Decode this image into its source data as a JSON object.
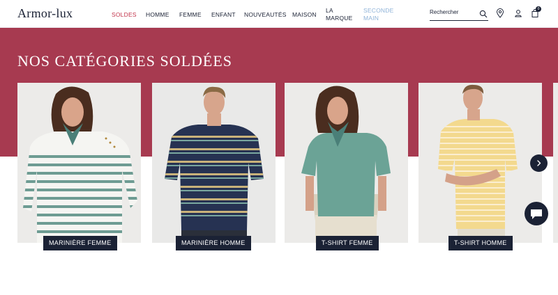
{
  "header": {
    "logo": "Armor-lux",
    "nav": [
      "SOLDES",
      "HOMME",
      "FEMME",
      "ENFANT",
      "NOUVEAUTÉS",
      "MAISON"
    ],
    "nav_la_marque": [
      "LA",
      "MARQUE"
    ],
    "nav_seconde_main": [
      "SECONDE",
      "MAIN"
    ],
    "search_placeholder": "Rechercher",
    "cart_count": "0",
    "icons": [
      "search-icon",
      "location-pin-icon",
      "account-icon",
      "cart-icon"
    ]
  },
  "hero": {
    "title": "NOS CATÉGORIES SOLDÉES",
    "band_color": "#a73a50"
  },
  "categories": [
    {
      "label": "MARINIÈRE FEMME"
    },
    {
      "label": "MARINIÈRE HOMME"
    },
    {
      "label": "T-SHIRT FEMME"
    },
    {
      "label": "T-SHIRT HOMME"
    }
  ],
  "controls": {
    "next_icon": "chevron-right-icon",
    "chat_icon": "chat-bubble-icon"
  },
  "colors": {
    "navy": "#1b2235",
    "sale_red": "#c2344b",
    "second_hand_blue": "#8fb3d8"
  }
}
